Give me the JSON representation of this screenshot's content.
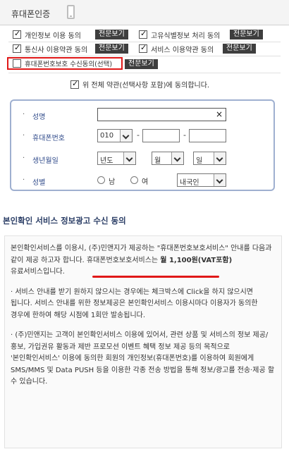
{
  "header": {
    "title": "휴대폰인증"
  },
  "consents": [
    {
      "label": "개인정보 이용 동의",
      "checked": true,
      "button": "전문보기"
    },
    {
      "label": "고유식별정보 처리 동의",
      "checked": true,
      "button": "전문보기"
    },
    {
      "label": "통신사 이용약관 동의",
      "checked": true,
      "button": "전문보기"
    },
    {
      "label": "서비스 이용약관 동의",
      "checked": true,
      "button": "전문보기"
    },
    {
      "label": "휴대폰번호보호 수신동의(선택)",
      "checked": false,
      "button": "전문보기"
    }
  ],
  "agree_all": {
    "label": "위 전체 약관(선택사항 포함)에 동의합니다.",
    "checked": true
  },
  "form": {
    "name_label": "성명",
    "name_value": "",
    "phone_label": "휴대폰번호",
    "phone_prefix": "010",
    "phone_sep": "-",
    "birth_label": "생년월일",
    "year_select": "년도",
    "month_select": "월",
    "day_select": "일",
    "gender_label": "성별",
    "gender_male": "남",
    "gender_female": "여",
    "nationality_select": "내국인",
    "clear_glyph": "×"
  },
  "ad_section": {
    "title": "본인확인 서비스 정보광고 수신 동의",
    "p1_a": "본인확인서비스를 이용시, (주)민앤지가 제공하는 \"휴대폰번호보호서비스\" 안내를 다음과 같이 제공 하고자 합니다. 휴대폰번호보호서비스는 ",
    "p1_hl": "월 1,100원(VAT포함)",
    "p1_b": " 유료서비스입니다.",
    "p2": "· 서비스 안내를 받기 원하지 않으시는 경우에는 체크박스에 Click을 하지 않으시면 됩니다. 서비스 안내를 위한 정보제공은 본인확인서비스 이용시마다 이용자가 동의한 경우에 한하여 해당 시점에 1회만 발송됩니다.",
    "p3": "· (주)민앤지는 고객이 본인확인서비스 이용에 있어서, 관련 상품 및 서비스의 정보 제공/홍보, 가입권유 활동과 제반 프로모션 이벤트 혜택 정보 제공 등의 목적으로 '본인확인서비스' 이용에 동의한 회원의 개인정보(휴대폰번호)를 이용하여 회원에게 SMS/MMS 및 Data PUSH 등을 이용한 각종 전송 방법을 통해 정보/광고를 전송·제공 할 수 있습니다."
  },
  "colors": {
    "highlight": "#e01818",
    "accent_blue": "#2f4a8a",
    "button_dark": "#3e3e3e"
  }
}
